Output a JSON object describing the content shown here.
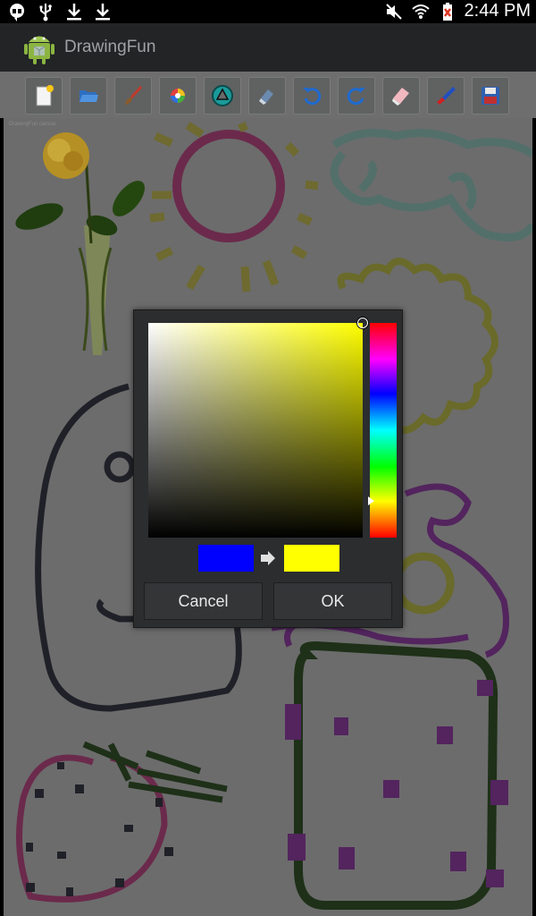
{
  "status_bar": {
    "time": "2:44 PM",
    "icons": [
      "hangouts-icon",
      "usb-icon",
      "download-icon",
      "download-icon",
      "mute-icon",
      "wifi-icon",
      "battery-icon"
    ]
  },
  "action_bar": {
    "title": "DrawingFun",
    "icon": "android-icon"
  },
  "toolbar": {
    "tools": [
      "new-file-icon",
      "open-folder-icon",
      "brush-icon",
      "color-wheel-icon",
      "shape-icon",
      "eraser-icon",
      "undo-icon",
      "redo-icon",
      "clear-icon",
      "marker-icon",
      "save-icon"
    ]
  },
  "canvas": {
    "tiny_label": "DrawingFun canvas"
  },
  "color_dialog": {
    "old_color": "#0000ff",
    "new_color": "#ffff00",
    "hue_color": "#ffff00",
    "cancel_label": "Cancel",
    "ok_label": "OK"
  },
  "colors": {
    "status_bar_bg": "#000000",
    "action_bar_bg": "#222426",
    "toolbar_bg": "#6e6e6e",
    "dialog_bg": "#2b2d2f"
  }
}
